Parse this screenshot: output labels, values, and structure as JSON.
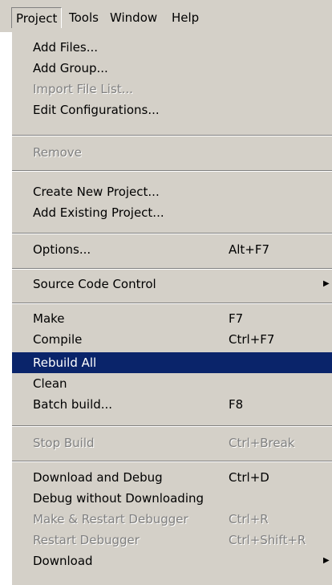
{
  "colors": {
    "menu_bg": "#d4d0c8",
    "selection_bg": "#0a246a",
    "disabled_text": "#808080"
  },
  "menubar": {
    "items": [
      {
        "label": "Project",
        "open": true
      },
      {
        "label": "Tools"
      },
      {
        "label": "Window"
      },
      {
        "label": "Help"
      }
    ]
  },
  "menu": {
    "add_files": {
      "label": "Add Files..."
    },
    "add_group": {
      "label": "Add Group..."
    },
    "import_file_list": {
      "label": "Import File List...",
      "disabled": true
    },
    "edit_configurations": {
      "label": "Edit Configurations..."
    },
    "remove": {
      "label": "Remove",
      "disabled": true
    },
    "create_new_project": {
      "label": "Create New Project..."
    },
    "add_existing_project": {
      "label": "Add Existing Project..."
    },
    "options": {
      "label": "Options...",
      "shortcut": "Alt+F7"
    },
    "source_code_control": {
      "label": "Source Code Control",
      "submenu": true,
      "arrow_icon": "submenu-arrow-icon"
    },
    "make": {
      "label": "Make",
      "shortcut": "F7"
    },
    "compile": {
      "label": "Compile",
      "shortcut": "Ctrl+F7"
    },
    "rebuild_all": {
      "label": "Rebuild All",
      "selected": true
    },
    "clean": {
      "label": "Clean"
    },
    "batch_build": {
      "label": "Batch build...",
      "shortcut": "F8"
    },
    "stop_build": {
      "label": "Stop Build",
      "shortcut": "Ctrl+Break",
      "disabled": true
    },
    "download_and_debug": {
      "label": "Download and Debug",
      "shortcut": "Ctrl+D"
    },
    "debug_without_downloading": {
      "label": "Debug without Downloading"
    },
    "make_restart_debugger": {
      "label": "Make & Restart Debugger",
      "shortcut": "Ctrl+R",
      "disabled": true
    },
    "restart_debugger": {
      "label": "Restart Debugger",
      "shortcut": "Ctrl+Shift+R",
      "disabled": true
    },
    "download": {
      "label": "Download",
      "submenu": true,
      "arrow_icon": "submenu-arrow-icon"
    }
  }
}
